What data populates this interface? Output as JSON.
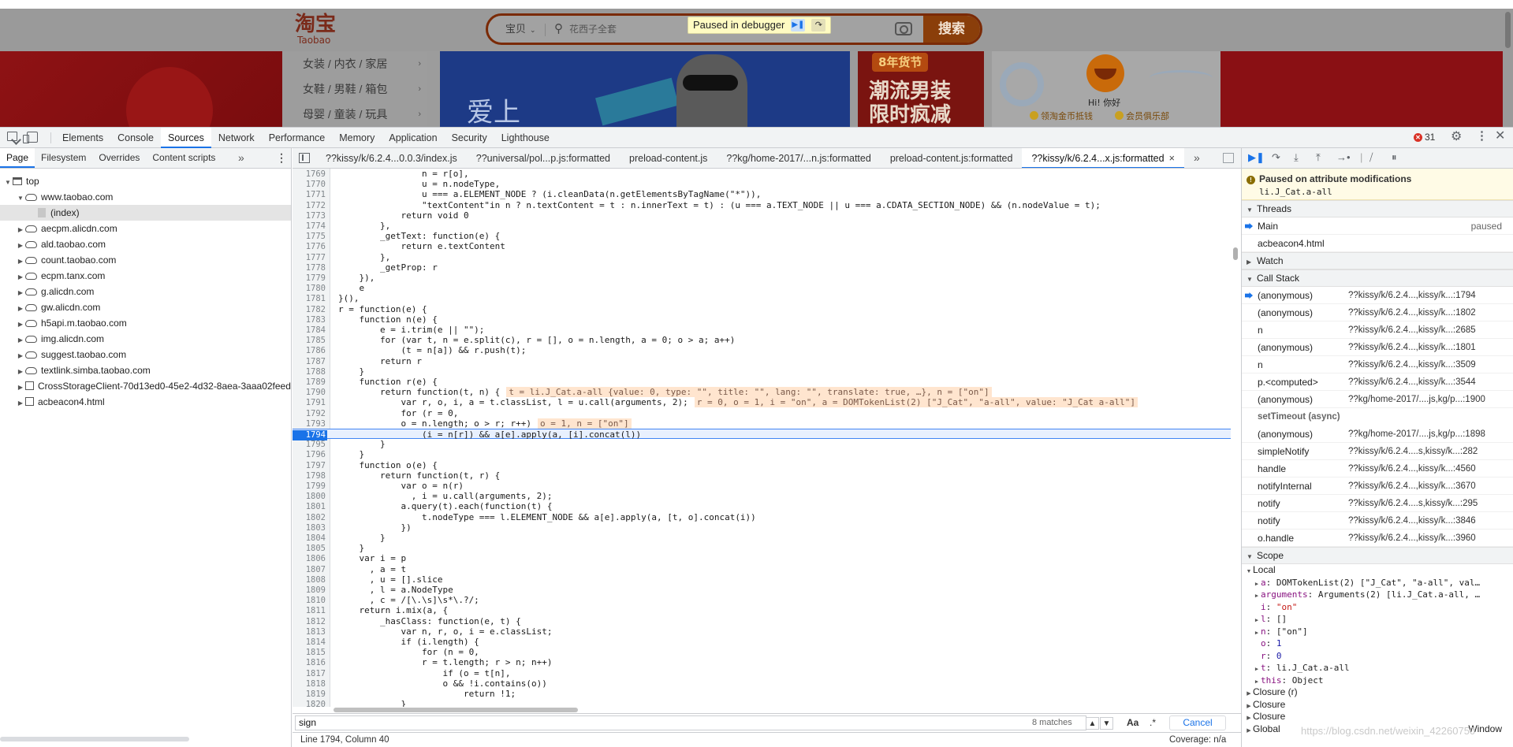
{
  "taobao": {
    "logo_cn": "淘宝",
    "logo_en": "Taobao",
    "search_category": "宝贝",
    "search_placeholder": "花西子全套",
    "search_button": "搜索",
    "categories": [
      "女装 / 内衣 / 家居",
      "女鞋 / 男鞋 / 箱包",
      "母婴 / 童装 / 玩具"
    ],
    "banner_text": "爱上",
    "promo_badge": "8年货节",
    "promo_big": "潮流男装\n限时疯减",
    "greeting": "Hi! 你好",
    "link_coins": "领淘金币抵钱",
    "link_club": "会员俱乐部"
  },
  "debugger_overlay": {
    "text": "Paused in debugger"
  },
  "devtools": {
    "main_tabs": [
      "Elements",
      "Console",
      "Sources",
      "Network",
      "Performance",
      "Memory",
      "Application",
      "Security",
      "Lighthouse"
    ],
    "active_tab": "Sources",
    "error_count": "31",
    "nav_tabs": [
      "Page",
      "Filesystem",
      "Overrides",
      "Content scripts"
    ],
    "tree": [
      {
        "label": "top",
        "depth": 0,
        "icon": "frame",
        "open": true
      },
      {
        "label": "www.taobao.com",
        "depth": 1,
        "icon": "cloud",
        "open": true
      },
      {
        "label": "(index)",
        "depth": 2,
        "icon": "file",
        "selected": true
      },
      {
        "label": "aecpm.alicdn.com",
        "depth": 1,
        "icon": "cloud"
      },
      {
        "label": "ald.taobao.com",
        "depth": 1,
        "icon": "cloud"
      },
      {
        "label": "count.taobao.com",
        "depth": 1,
        "icon": "cloud"
      },
      {
        "label": "ecpm.tanx.com",
        "depth": 1,
        "icon": "cloud"
      },
      {
        "label": "g.alicdn.com",
        "depth": 1,
        "icon": "cloud"
      },
      {
        "label": "gw.alicdn.com",
        "depth": 1,
        "icon": "cloud"
      },
      {
        "label": "h5api.m.taobao.com",
        "depth": 1,
        "icon": "cloud"
      },
      {
        "label": "img.alicdn.com",
        "depth": 1,
        "icon": "cloud"
      },
      {
        "label": "suggest.taobao.com",
        "depth": 1,
        "icon": "cloud"
      },
      {
        "label": "textlink.simba.taobao.com",
        "depth": 1,
        "icon": "cloud"
      },
      {
        "label": "CrossStorageClient-70d13ed0-45e2-4d32-8aea-3aaa02feed",
        "depth": 1,
        "icon": "box"
      },
      {
        "label": "acbeacon4.html",
        "depth": 1,
        "icon": "box"
      }
    ],
    "file_tabs": [
      "??kissy/k/6.2.4...0.0.3/index.js",
      "??universal/pol...p.js:formatted",
      "preload-content.js",
      "??kg/home-2017/...n.js:formatted",
      "preload-content.js:formatted",
      "??kissy/k/6.2.4...x.js:formatted"
    ],
    "active_file_tab": 5,
    "code_lines": [
      {
        "n": "1769",
        "t": "                n = r[o],"
      },
      {
        "n": "1770",
        "t": "                u = n.nodeType,"
      },
      {
        "n": "1771",
        "t": "                u === a.ELEMENT_NODE ? (i.cleanData(n.getElementsByTagName(\"*\")),"
      },
      {
        "n": "1772",
        "t": "                \"textContent\"in n ? n.textContent = t : n.innerText = t) : (u === a.TEXT_NODE || u === a.CDATA_SECTION_NODE) && (n.nodeValue = t);"
      },
      {
        "n": "1773",
        "t": "            return void 0"
      },
      {
        "n": "1774",
        "t": "        },"
      },
      {
        "n": "1775",
        "t": "        _getText: function(e) {"
      },
      {
        "n": "1776",
        "t": "            return e.textContent"
      },
      {
        "n": "1777",
        "t": "        },"
      },
      {
        "n": "1778",
        "t": "        _getProp: r"
      },
      {
        "n": "1779",
        "t": "    }),"
      },
      {
        "n": "1780",
        "t": "    e"
      },
      {
        "n": "1781",
        "t": "}(),"
      },
      {
        "n": "1782",
        "t": "r = function(e) {"
      },
      {
        "n": "1783",
        "t": "    function n(e) {"
      },
      {
        "n": "1784",
        "t": "        e = i.trim(e || \"\");"
      },
      {
        "n": "1785",
        "t": "        for (var t, n = e.split(c), r = [], o = n.length, a = 0; o > a; a++)"
      },
      {
        "n": "1786",
        "t": "            (t = n[a]) && r.push(t);"
      },
      {
        "n": "1787",
        "t": "        return r"
      },
      {
        "n": "1788",
        "t": "    }"
      },
      {
        "n": "1789",
        "t": "    function r(e) {"
      },
      {
        "n": "1790",
        "t": "        return function(t, n) {",
        "inline": "t = li.J_Cat.a-all {value: 0, type: \"\", title: \"\", lang: \"\", translate: true, …}, n = [\"on\"]"
      },
      {
        "n": "1791",
        "t": "            var r, o, i, a = t.classList, l = u.call(arguments, 2);",
        "inline": "r = 0, o = 1, i = \"on\", a = DOMTokenList(2) [\"J_Cat\", \"a-all\", value: \"J_Cat a-all\"]"
      },
      {
        "n": "1792",
        "t": "            for (r = 0,"
      },
      {
        "n": "1793",
        "t": "            o = n.length; o > r; r++)",
        "inline": "o = 1, n = [\"on\"]"
      },
      {
        "n": "1794",
        "t": "                (i = n[r]) && a[e].apply(a, [i].concat(l))",
        "exec": true
      },
      {
        "n": "1795",
        "t": "        }"
      },
      {
        "n": "1796",
        "t": "    }"
      },
      {
        "n": "1797",
        "t": "    function o(e) {"
      },
      {
        "n": "1798",
        "t": "        return function(t, r) {"
      },
      {
        "n": "1799",
        "t": "            var o = n(r)"
      },
      {
        "n": "1800",
        "t": "              , i = u.call(arguments, 2);"
      },
      {
        "n": "1801",
        "t": "            a.query(t).each(function(t) {"
      },
      {
        "n": "1802",
        "t": "                t.nodeType === l.ELEMENT_NODE && a[e].apply(a, [t, o].concat(i))"
      },
      {
        "n": "1803",
        "t": "            })"
      },
      {
        "n": "1804",
        "t": "        }"
      },
      {
        "n": "1805",
        "t": "    }"
      },
      {
        "n": "1806",
        "t": "    var i = p"
      },
      {
        "n": "1807",
        "t": "      , a = t"
      },
      {
        "n": "1808",
        "t": "      , u = [].slice"
      },
      {
        "n": "1809",
        "t": "      , l = a.NodeType"
      },
      {
        "n": "1810",
        "t": "      , c = /[\\.\\s]\\s*\\.?/;"
      },
      {
        "n": "1811",
        "t": "    return i.mix(a, {"
      },
      {
        "n": "1812",
        "t": "        _hasClass: function(e, t) {"
      },
      {
        "n": "1813",
        "t": "            var n, r, o, i = e.classList;"
      },
      {
        "n": "1814",
        "t": "            if (i.length) {"
      },
      {
        "n": "1815",
        "t": "                for (n = 0,"
      },
      {
        "n": "1816",
        "t": "                r = t.length; r > n; n++)"
      },
      {
        "n": "1817",
        "t": "                    if (o = t[n],"
      },
      {
        "n": "1818",
        "t": "                    o && !i.contains(o))"
      },
      {
        "n": "1819",
        "t": "                        return !1;"
      },
      {
        "n": "1820",
        "t": "            }"
      }
    ],
    "search_query": "sign",
    "search_matches": "8 matches",
    "search_aa": "Aa",
    "search_regex": ".*",
    "cancel_label": "Cancel",
    "status_position": "Line 1794, Column 40",
    "status_coverage": "Coverage: n/a",
    "paused_title": "Paused on attribute modifications",
    "paused_target": "li.J_Cat.a-all",
    "threads_label": "Threads",
    "threads": [
      {
        "name": "Main",
        "status": "paused",
        "current": true
      },
      {
        "name": "acbeacon4.html",
        "status": ""
      }
    ],
    "watch_label": "Watch",
    "callstack_label": "Call Stack",
    "callstack": [
      {
        "fn": "(anonymous)",
        "loc": "??kissy/k/6.2.4...,kissy/k...:1794",
        "current": true
      },
      {
        "fn": "(anonymous)",
        "loc": "??kissy/k/6.2.4...,kissy/k...:1802"
      },
      {
        "fn": "n",
        "loc": "??kissy/k/6.2.4...,kissy/k...:2685"
      },
      {
        "fn": "(anonymous)",
        "loc": "??kissy/k/6.2.4...,kissy/k...:1801"
      },
      {
        "fn": "n",
        "loc": "??kissy/k/6.2.4...,kissy/k...:3509"
      },
      {
        "fn": "p.<computed>",
        "loc": "??kissy/k/6.2.4...,kissy/k...:3544"
      },
      {
        "fn": "(anonymous)",
        "loc": "??kg/home-2017/....js,kg/p...:1900"
      },
      {
        "fn": "setTimeout (async)",
        "loc": "",
        "async": true
      },
      {
        "fn": "(anonymous)",
        "loc": "??kg/home-2017/....js,kg/p...:1898"
      },
      {
        "fn": "simpleNotify",
        "loc": "??kissy/k/6.2.4....s,kissy/k...:282"
      },
      {
        "fn": "handle",
        "loc": "??kissy/k/6.2.4...,kissy/k...:4560"
      },
      {
        "fn": "notifyInternal",
        "loc": "??kissy/k/6.2.4...,kissy/k...:3670"
      },
      {
        "fn": "notify",
        "loc": "??kissy/k/6.2.4....s,kissy/k...:295"
      },
      {
        "fn": "notify",
        "loc": "??kissy/k/6.2.4...,kissy/k...:3846"
      },
      {
        "fn": "o.handle",
        "loc": "??kissy/k/6.2.4...,kissy/k...:3960"
      }
    ],
    "scope_label": "Scope",
    "local_label": "Local",
    "scope_vars": [
      {
        "k": "a",
        "v": "DOMTokenList(2) [\"J_Cat\", \"a-all\", val…",
        "exp": true
      },
      {
        "k": "arguments",
        "v": "Arguments(2) [li.J_Cat.a-all, …",
        "exp": true
      },
      {
        "k": "i",
        "v": "\"on\"",
        "exp": false
      },
      {
        "k": "l",
        "v": "[]",
        "exp": true
      },
      {
        "k": "n",
        "v": "[\"on\"]",
        "exp": true
      },
      {
        "k": "o",
        "v": "1",
        "exp": false
      },
      {
        "k": "r",
        "v": "0",
        "exp": false
      },
      {
        "k": "t",
        "v": "li.J_Cat.a-all",
        "exp": true
      },
      {
        "k": "this",
        "v": "Object",
        "exp": true
      }
    ],
    "closures": [
      "Closure (r)",
      "Closure",
      "Closure",
      "Global"
    ],
    "global_value": "Window"
  },
  "watermark": "https://blog.csdn.net/weixin_42260750"
}
